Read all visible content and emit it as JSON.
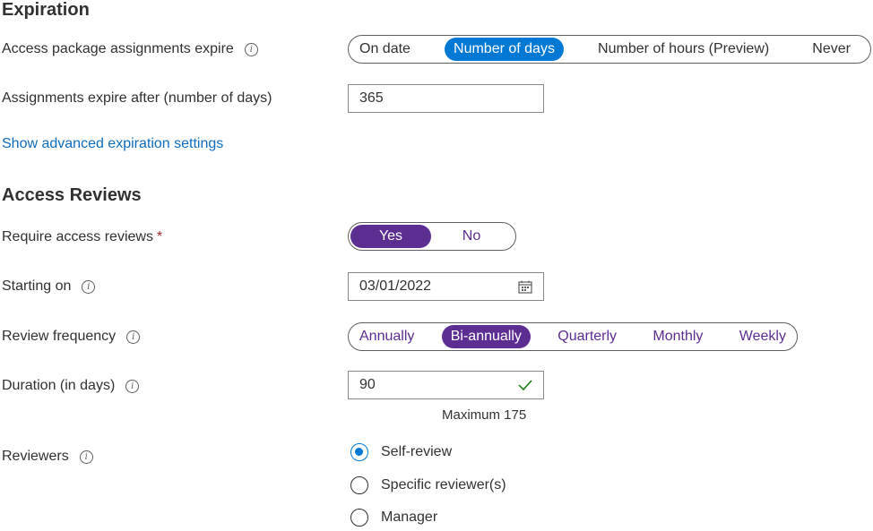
{
  "expiration": {
    "title": "Expiration",
    "expire_label": "Access package assignments expire",
    "expire_options": [
      "On date",
      "Number of days",
      "Number of hours (Preview)",
      "Never"
    ],
    "expire_selected": "Number of days",
    "days_label": "Assignments expire after (number of days)",
    "days_value": "365",
    "advanced_link": "Show advanced expiration settings"
  },
  "access_reviews": {
    "title": "Access Reviews",
    "require_label": "Require access reviews",
    "require_marker": "*",
    "require_options": [
      "Yes",
      "No"
    ],
    "require_selected": "Yes",
    "starting_label": "Starting on",
    "starting_value": "03/01/2022",
    "frequency_label": "Review frequency",
    "frequency_options": [
      "Annually",
      "Bi-annually",
      "Quarterly",
      "Monthly",
      "Weekly"
    ],
    "frequency_selected": "Bi-annually",
    "duration_label": "Duration (in days)",
    "duration_value": "90",
    "duration_hint": "Maximum 175",
    "reviewers_label": "Reviewers",
    "reviewer_options": [
      "Self-review",
      "Specific reviewer(s)",
      "Manager"
    ],
    "reviewer_selected": "Self-review"
  },
  "colors": {
    "selected_blue": "#0078d4",
    "selected_purple": "#5c2e91",
    "option_purple": "#5c2e91",
    "link": "#0f6cbd",
    "check": "#107c10"
  },
  "icons": {
    "info": "info-icon",
    "calendar": "calendar-icon",
    "check": "checkmark-icon"
  }
}
